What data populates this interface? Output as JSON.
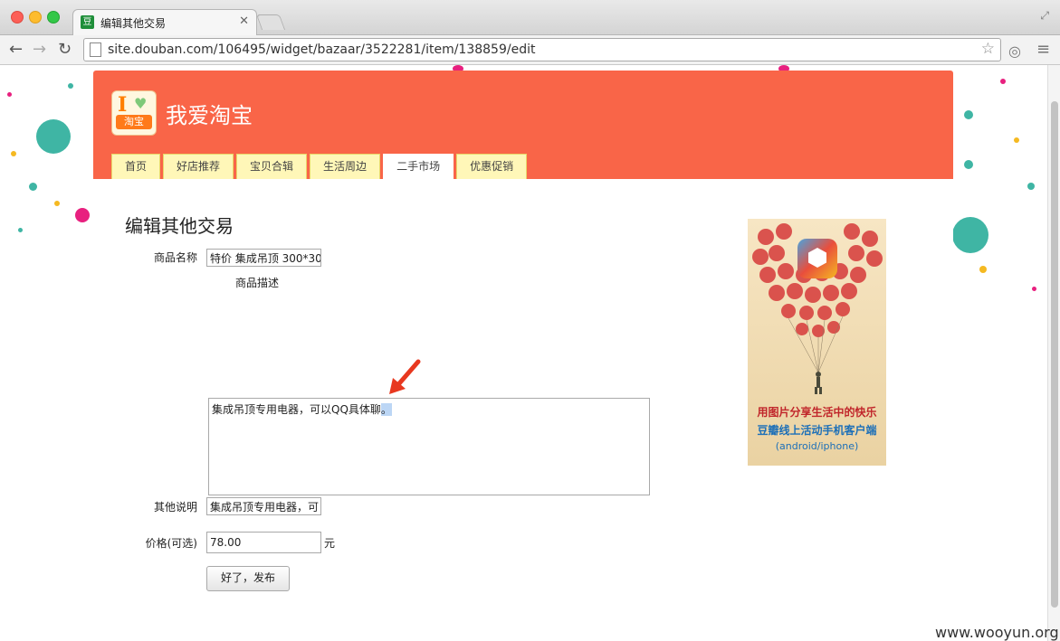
{
  "browser": {
    "tab_title": "编辑其他交易",
    "tab_favicon": "豆",
    "url": "site.douban.com/106495/widget/bazaar/3522281/item/138859/edit"
  },
  "site": {
    "title": "我爱淘宝",
    "logo_letter": "I",
    "logo_text": "淘宝",
    "nav": [
      {
        "label": "首页",
        "active": false
      },
      {
        "label": "好店推荐",
        "active": false
      },
      {
        "label": "宝贝合辑",
        "active": false
      },
      {
        "label": "生活周边",
        "active": false
      },
      {
        "label": "二手市场",
        "active": true
      },
      {
        "label": "优惠促销",
        "active": false
      }
    ]
  },
  "form": {
    "heading": "编辑其他交易",
    "name_label": "商品名称",
    "name_value": "特价 集成吊顶 300*30",
    "desc_label": "商品描述",
    "desc_text": "集成吊顶专用电器，可以QQ具体聊",
    "desc_selected": "。",
    "other_label": "其他说明",
    "other_value": "集成吊顶专用电器，可",
    "price_label": "价格(可选)",
    "price_value": "78.00",
    "price_unit": "元",
    "submit_label": "好了，发布"
  },
  "ad": {
    "line1": "用图片分享生活中的快乐",
    "line2": "豆瓣线上活动手机客户端",
    "line3": "(android/iphone)"
  },
  "watermark": "www.wooyun.org",
  "colors": {
    "header": "#f96548",
    "nav_tab": "#fff7b8",
    "arrow": "#e8381f"
  }
}
